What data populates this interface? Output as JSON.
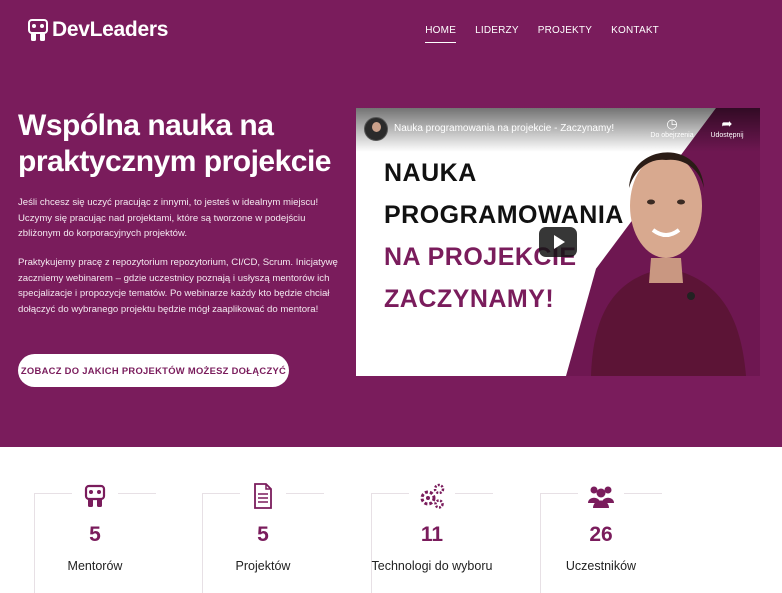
{
  "brand": {
    "name": "DevLeaders",
    "accent": "#7a1c5c"
  },
  "nav": {
    "items": [
      {
        "label": "HOME",
        "active": true
      },
      {
        "label": "LIDERZY",
        "active": false
      },
      {
        "label": "PROJEKTY",
        "active": false
      },
      {
        "label": "KONTAKT",
        "active": false
      }
    ]
  },
  "hero": {
    "title": "Wspólna nauka na praktycznym projekcie",
    "paragraph1": "Jeśli chcesz się uczyć pracując z innymi, to jesteś w idealnym miejscu! Uczymy się pracując nad projektami, które są tworzone w podejściu zbliżonym do korporacyjnych projektów.",
    "paragraph2": "Praktykujemy pracę z repozytorium repozytorium, CI/CD, Scrum. Inicjatywę zaczniemy webinarem – gdzie uczestnicy poznają i usłyszą mentorów ich specjalizacje i propozycje tematów. Po webinarze każdy kto będzie chciał dołączyć do wybranego projektu będzie mógł zaaplikować do mentora!",
    "cta_label": "ZOBACZ DO JAKICH PROJEKTÓW MOŻESZ DOŁĄCZYĆ"
  },
  "video": {
    "title": "Nauka programowania na projekcie - Zaczynamy!",
    "watch_later_label": "Do obejrzenia",
    "share_label": "Udostępnij",
    "thumbnail_lines": [
      "NAUKA",
      "PROGRAMOWANIA",
      "NA PROJEKCIE",
      "ZACZYNAMY!"
    ]
  },
  "stats": [
    {
      "icon": "mentor-icon",
      "value": "5",
      "label": "Mentorów"
    },
    {
      "icon": "document-icon",
      "value": "5",
      "label": "Projektów"
    },
    {
      "icon": "gears-icon",
      "value": "11",
      "label": "Technologi do wyboru"
    },
    {
      "icon": "users-icon",
      "value": "26",
      "label": "Uczestników"
    }
  ]
}
